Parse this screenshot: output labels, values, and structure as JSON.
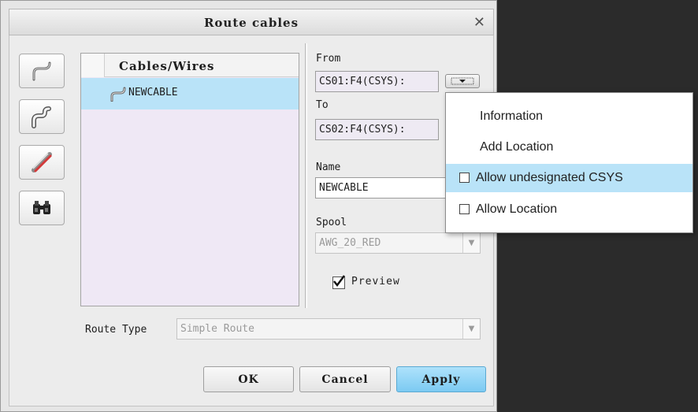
{
  "dialog": {
    "title": "Route cables",
    "close_icon": "close-icon"
  },
  "toolbar": {
    "buttons": [
      {
        "icon": "route-cable-icon"
      },
      {
        "icon": "route-bundle-icon"
      },
      {
        "icon": "ribbon-cable-icon"
      },
      {
        "icon": "binoculars-icon"
      }
    ]
  },
  "cable_list": {
    "header": "Cables/Wires",
    "items": [
      {
        "name": "NEWCABLE",
        "icon": "cable-icon",
        "selected": true
      }
    ]
  },
  "from": {
    "label": "From",
    "value": "CS01:F4(CSYS):"
  },
  "to": {
    "label": "To",
    "value": "CS02:F4(CSYS):"
  },
  "name": {
    "label": "Name",
    "value": "NEWCABLE"
  },
  "spool": {
    "label": "Spool",
    "value": "AWG_20_RED"
  },
  "preview": {
    "label": "Preview",
    "checked": true
  },
  "route_type": {
    "label": "Route Type",
    "value": "Simple Route"
  },
  "buttons": {
    "ok": "OK",
    "cancel": "Cancel",
    "apply": "Apply"
  },
  "popup_menu": {
    "items": [
      {
        "label": "Information",
        "checkbox": false
      },
      {
        "label": "Add Location",
        "checkbox": false
      },
      {
        "label": "Allow undesignated CSYS",
        "checkbox": true,
        "checked": false,
        "highlighted": true
      },
      {
        "label": "Allow Location",
        "checkbox": true,
        "checked": false
      }
    ]
  },
  "colors": {
    "selection": "#b9e3f8",
    "list_background": "#efe8f5",
    "apply_button": "#7ccaf2"
  }
}
